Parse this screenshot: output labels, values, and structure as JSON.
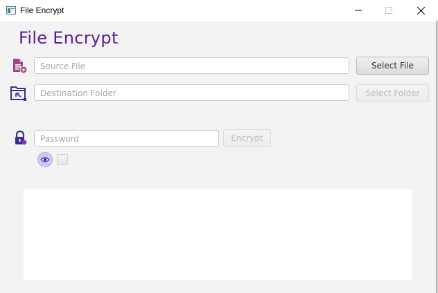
{
  "window": {
    "title": "File Encrypt",
    "minimize_glyph": "—",
    "maximize_glyph": "☐",
    "close_glyph": "✕"
  },
  "app": {
    "heading": "File Encrypt"
  },
  "source": {
    "placeholder": "Source File",
    "value": "",
    "icon": "file-add-icon",
    "button_label": "Select File"
  },
  "destination": {
    "placeholder": "Destination Folder",
    "value": "",
    "icon": "folder-open-icon",
    "button_label": "Select Folder",
    "button_enabled": false
  },
  "password": {
    "placeholder": "Password",
    "value": "",
    "icon": "lock-icon",
    "button_label": "Encrypt",
    "button_enabled": false,
    "show_password_icon": "eye-icon",
    "show_password_checked": false
  },
  "output": {
    "text": ""
  },
  "colors": {
    "accent": "#5b1b9b",
    "icon_primary": "#7a3ea8",
    "window_bg": "#f3f3f3"
  }
}
